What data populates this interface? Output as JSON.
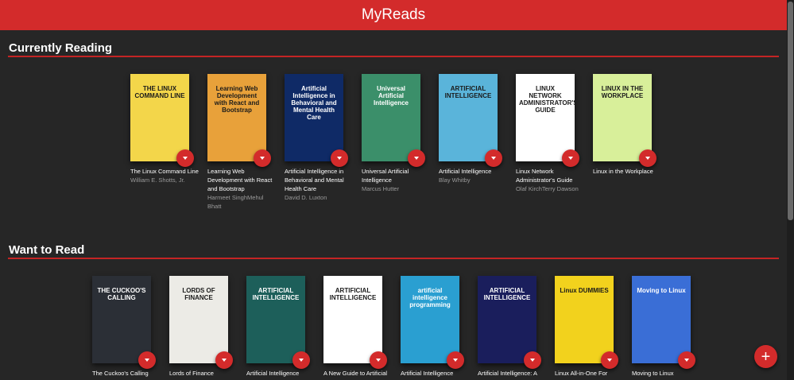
{
  "app": {
    "title": "MyReads"
  },
  "accent_color": "#d32b2b",
  "add_button_label": "+",
  "shelves": [
    {
      "title": "Currently Reading",
      "books": [
        {
          "title": "The Linux Command Line",
          "authors": "William E. Shotts, Jr.",
          "cover_text": "THE LINUX COMMAND LINE",
          "cover_color": "#f3d64a"
        },
        {
          "title": "Learning Web Development with React and Bootstrap",
          "authors": "Harmeet SinghMehul Bhatt",
          "cover_text": "Learning Web Development with React and Bootstrap",
          "cover_color": "#e8a13a"
        },
        {
          "title": "Artificial Intelligence in Behavioral and Mental Health Care",
          "authors": "David D. Luxton",
          "cover_text": "Artificial Intelligence in Behavioral and Mental Health Care",
          "cover_color": "#0f2a66"
        },
        {
          "title": "Universal Artificial Intelligence",
          "authors": "Marcus Hutter",
          "cover_text": "Universal Artificial Intelligence",
          "cover_color": "#3b8f6a"
        },
        {
          "title": "Artificial Intelligence",
          "authors": "Blay Whitby",
          "cover_text": "ARTIFICIAL INTELLIGENCE",
          "cover_color": "#5ab4da"
        },
        {
          "title": "Linux Network Administrator's Guide",
          "authors": "Olaf KirchTerry Dawson",
          "cover_text": "LINUX NETWORK ADMINISTRATOR'S GUIDE",
          "cover_color": "#ffffff"
        },
        {
          "title": "Linux in the Workplace",
          "authors": "",
          "cover_text": "LINUX IN THE WORKPLACE",
          "cover_color": "#d8ef9a"
        }
      ]
    },
    {
      "title": "Want to Read",
      "books": [
        {
          "title": "The Cuckoo's Calling",
          "authors": "",
          "cover_text": "THE CUCKOO'S CALLING",
          "cover_color": "#2b2f36"
        },
        {
          "title": "Lords of Finance",
          "authors": "",
          "cover_text": "LORDS OF FINANCE",
          "cover_color": "#ecebe6"
        },
        {
          "title": "Artificial Intelligence",
          "authors": "",
          "cover_text": "ARTIFICIAL INTELLIGENCE",
          "cover_color": "#1d5f5a"
        },
        {
          "title": "A New Guide to Artificial",
          "authors": "",
          "cover_text": "ARTIFICIAL INTELLIGENCE",
          "cover_color": "#ffffff"
        },
        {
          "title": "Artificial Intelligence",
          "authors": "",
          "cover_text": "artificial intelligence programming",
          "cover_color": "#2a9fd1"
        },
        {
          "title": "Artificial Intelligence: A",
          "authors": "",
          "cover_text": "ARTIFICIAL INTELLIGENCE",
          "cover_color": "#1a1e5c"
        },
        {
          "title": "Linux All-in-One For",
          "authors": "",
          "cover_text": "Linux DUMMIES",
          "cover_color": "#f2d21d"
        },
        {
          "title": "Moving to Linux",
          "authors": "",
          "cover_text": "Moving to Linux",
          "cover_color": "#3a6ed6"
        }
      ]
    }
  ]
}
